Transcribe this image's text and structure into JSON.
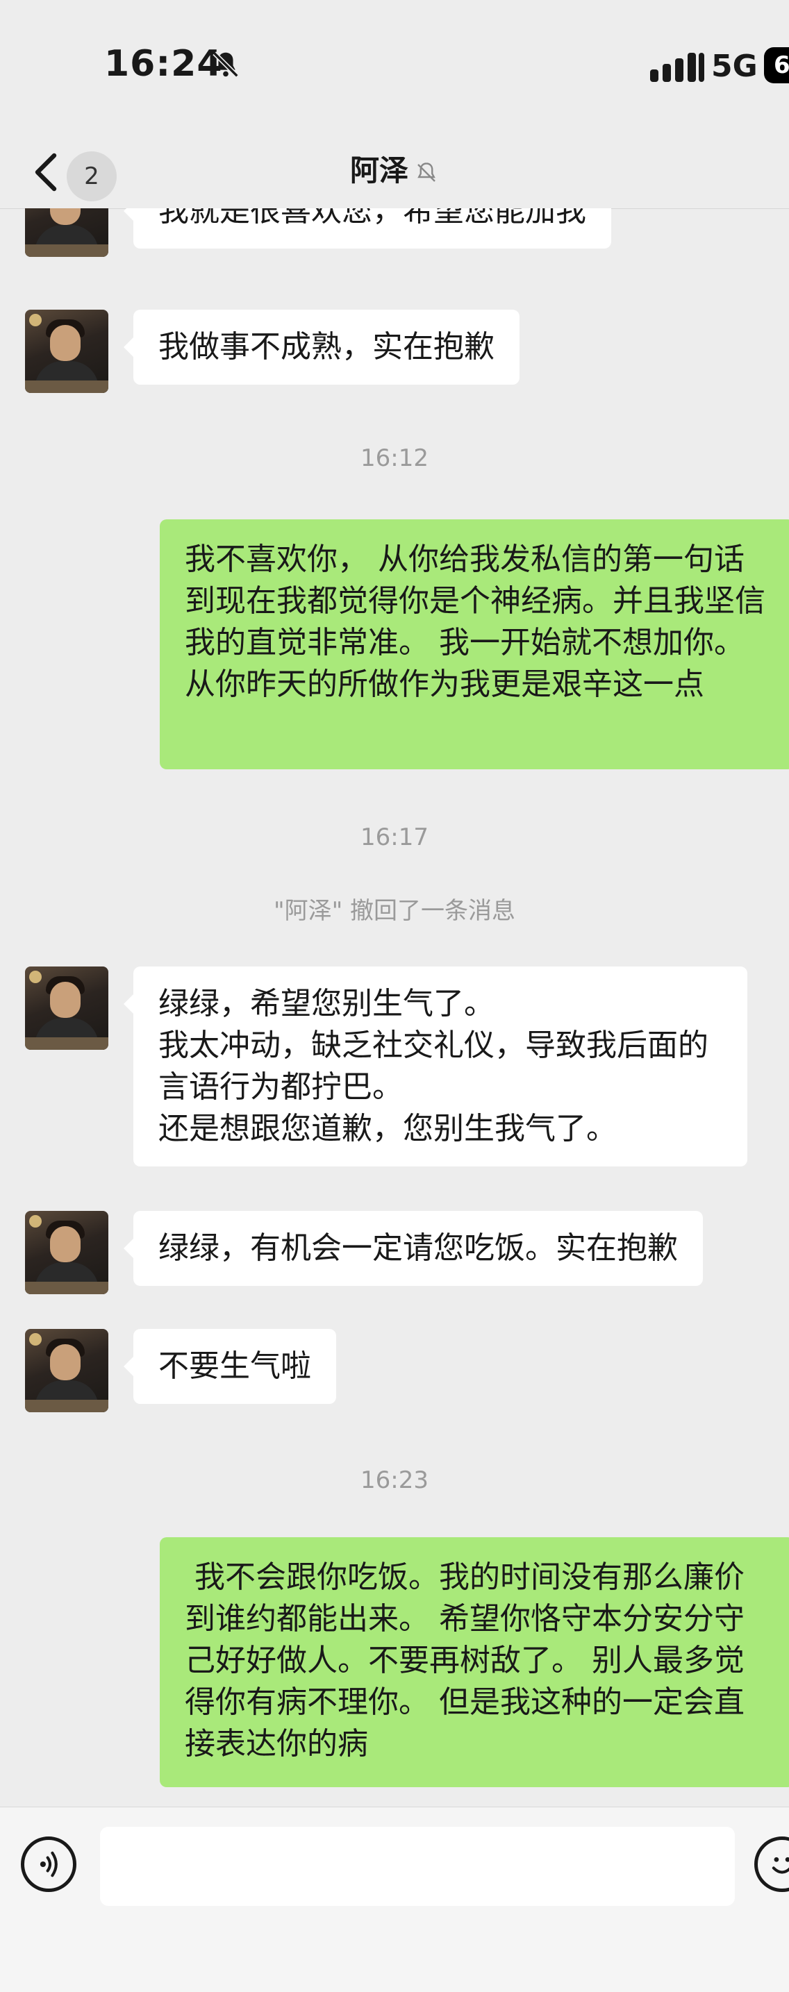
{
  "status_bar": {
    "time": "16:24",
    "network": "5G",
    "battery": "6",
    "icons": [
      "bell-muted-icon",
      "signal-icon"
    ]
  },
  "nav": {
    "back_icon": "chevron-left-icon",
    "unread_count": "2",
    "title": "阿泽",
    "title_icon": "bell-muted-icon"
  },
  "messages": [
    {
      "type": "in",
      "text": "我就是很喜欢您，希望您能加我"
    },
    {
      "type": "in",
      "text": "我做事不成熟，实在抱歉"
    },
    {
      "type": "time",
      "text": "16:12"
    },
    {
      "type": "out",
      "text": "我不喜欢你， 从你给我发私信的第一句话到现在我都觉得你是个神经病。并且我坚信我的直觉非常准。 我一开始就不想加你。从你昨天的所做作为我更是艰辛这一点"
    },
    {
      "type": "time",
      "text": "16:17"
    },
    {
      "type": "system",
      "text": "\"阿泽\" 撤回了一条消息"
    },
    {
      "type": "in",
      "text": "绿绿，希望您别生气了。\n我太冲动，缺乏社交礼仪，导致我后面的言语行为都拧巴。\n还是想跟您道歉，您别生我气了。"
    },
    {
      "type": "in",
      "text": "绿绿，有机会一定请您吃饭。实在抱歉"
    },
    {
      "type": "in",
      "text": "不要生气啦"
    },
    {
      "type": "time",
      "text": "16:23"
    },
    {
      "type": "out",
      "text": " 我不会跟你吃饭。我的时间没有那么廉价到谁约都能出来。 希望你恪守本分安分守己好好做人。不要再树敌了。 别人最多觉得你有病不理你。 但是我这种的一定会直接表达你的病"
    }
  ],
  "composer": {
    "voice_icon": "voice-icon",
    "emoji_icon": "emoji-icon",
    "input_value": ""
  }
}
